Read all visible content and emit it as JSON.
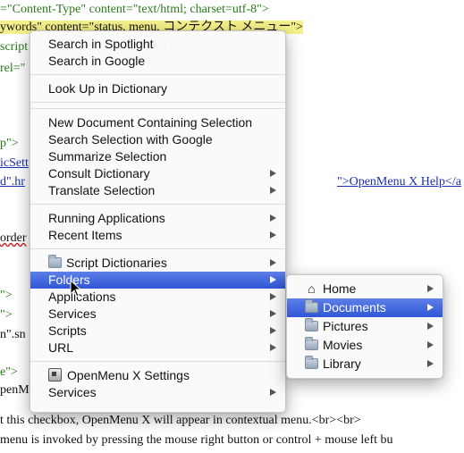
{
  "background_lines": [
    {
      "text": "=\"Content-Type\" content=\"text/html; charset=utf-8\">",
      "style": "green"
    },
    {
      "text": "ywords\" content=\"status, menu, コンテクスト メニュー\">",
      "style": "highlight"
    },
    {
      "text": "script  OpenMenu X ... contextual menu\">",
      "style": "green"
    },
    {
      "text": "rel=\"",
      "style": "green"
    },
    {
      "text": "",
      "style": "plain"
    },
    {
      "text": "",
      "style": "plain"
    },
    {
      "text": "p\">",
      "style": "green"
    },
    {
      "text": "icSett",
      "style": "blue"
    },
    {
      "text": "d\".hr",
      "style": "blue"
    },
    {
      "text": "\">OpenMenu X Help</a",
      "style": "blue"
    },
    {
      "text": "",
      "style": "plain"
    },
    {
      "text": "order",
      "style": "red"
    },
    {
      "text": "",
      "style": "plain"
    },
    {
      "text": "",
      "style": "plain"
    },
    {
      "text": "\">",
      "style": "green"
    },
    {
      "text": "\">",
      "style": "green"
    },
    {
      "text": "n\".sn",
      "style": "plain"
    },
    {
      "text": "",
      "style": "plain"
    },
    {
      "text": "e\">",
      "style": "green"
    },
    {
      "text": "penMe",
      "style": "plain"
    },
    {
      "text": "",
      "style": "plain"
    },
    {
      "text": "t this checkbox, OpenMenu X will appear in contextual menu.<br><br>",
      "style": "plain"
    },
    {
      "text": "menu is invoked by pressing the mouse right button or control + mouse left bu",
      "style": "plain"
    }
  ],
  "main_menu": {
    "groups": [
      [
        {
          "label": "Search in Spotlight",
          "submenu": false
        },
        {
          "label": "Search in Google",
          "submenu": false
        }
      ],
      [
        {
          "label": "Look Up in Dictionary",
          "submenu": false
        }
      ],
      [],
      [
        {
          "label": "New Document Containing Selection",
          "submenu": false
        },
        {
          "label": "Search Selection with Google",
          "submenu": false
        },
        {
          "label": "Summarize Selection",
          "submenu": false
        },
        {
          "label": "Consult Dictionary",
          "submenu": true
        },
        {
          "label": "Translate Selection",
          "submenu": true
        }
      ],
      [
        {
          "label": "Running Applications",
          "submenu": true
        },
        {
          "label": "Recent Items",
          "submenu": true
        }
      ],
      [
        {
          "label": "Script Dictionaries",
          "submenu": true,
          "icon": "folder-icon"
        },
        {
          "label": "Folders",
          "submenu": true,
          "selected": true
        },
        {
          "label": "Applications",
          "submenu": true
        },
        {
          "label": "Services",
          "submenu": true
        },
        {
          "label": "Scripts",
          "submenu": true
        },
        {
          "label": "URL",
          "submenu": true
        }
      ],
      [
        {
          "label": "OpenMenu X Settings",
          "submenu": false,
          "icon": "settings-icon"
        },
        {
          "label": "Services",
          "submenu": true
        }
      ]
    ]
  },
  "folders_submenu": [
    {
      "label": "Home",
      "icon": "home-icon",
      "submenu": true
    },
    {
      "label": "Documents",
      "icon": "folder-icon",
      "submenu": true,
      "selected": true
    },
    {
      "label": "Pictures",
      "icon": "folder-icon",
      "submenu": true
    },
    {
      "label": "Movies",
      "icon": "folder-icon",
      "submenu": true
    },
    {
      "label": "Library",
      "icon": "folder-icon",
      "submenu": true
    }
  ],
  "colors": {
    "selection": "#3a62dc",
    "tag_green": "#2a7a1a",
    "link_blue": "#1b2fb0",
    "highlight_yellow": "#f4f08a"
  }
}
